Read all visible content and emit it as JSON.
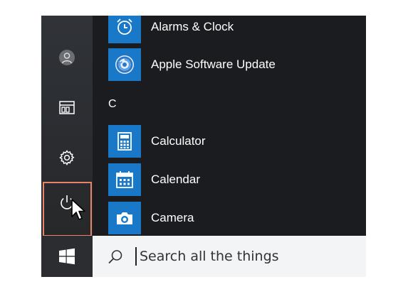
{
  "start_menu": {
    "rail": {
      "user": {
        "icon": "user-avatar-icon"
      },
      "documents": {
        "icon": "documents-folder-icon"
      },
      "settings": {
        "icon": "gear-icon"
      },
      "power": {
        "icon": "power-icon",
        "highlight_color": "#e8836b"
      }
    },
    "apps": [
      {
        "label": "Alarms & Clock",
        "icon": "alarm-clock-icon"
      },
      {
        "label": "Apple Software Update",
        "icon": "apple-update-icon"
      },
      {
        "section": "C"
      },
      {
        "label": "Calculator",
        "icon": "calculator-icon"
      },
      {
        "label": "Calendar",
        "icon": "calendar-icon"
      },
      {
        "label": "Camera",
        "icon": "camera-icon"
      }
    ],
    "tile_color": "#1a78c9"
  },
  "taskbar": {
    "start_button_icon": "windows-logo-icon",
    "search": {
      "placeholder": "Search all the things",
      "value": ""
    }
  }
}
